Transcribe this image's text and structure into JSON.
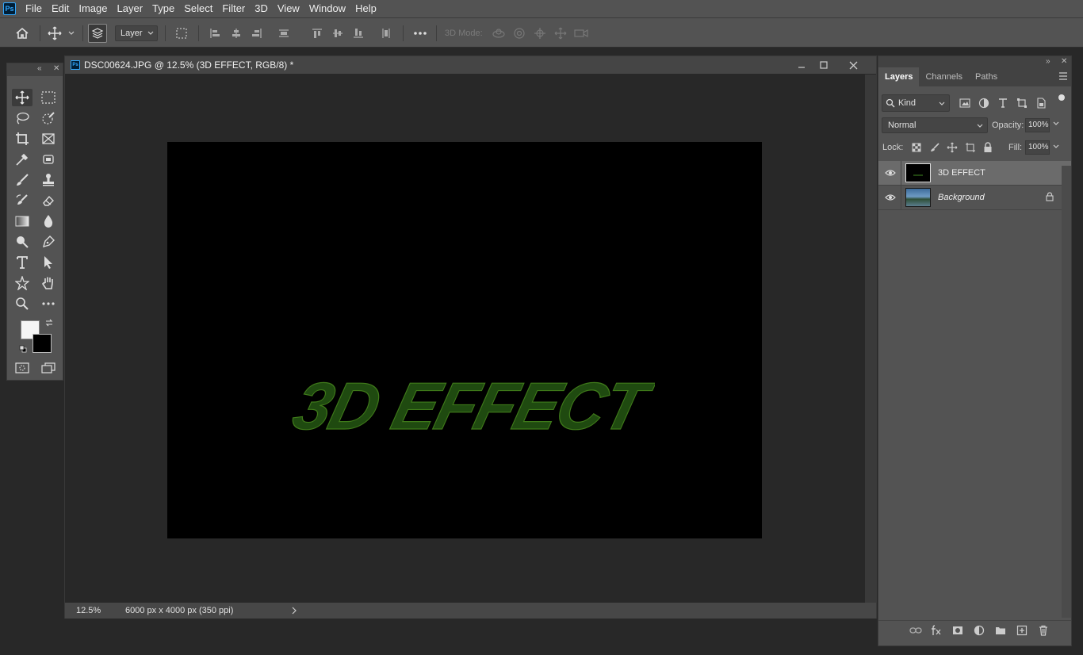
{
  "app": {
    "logo": "Ps"
  },
  "menu": [
    "File",
    "Edit",
    "Image",
    "Layer",
    "Type",
    "Select",
    "Filter",
    "3D",
    "View",
    "Window",
    "Help"
  ],
  "options_bar": {
    "auto_select_target": "Layer",
    "mode_3d_label": "3D Mode:"
  },
  "document": {
    "tab_title": "DSC00624.JPG @ 12.5% (3D EFFECT, RGB/8) *",
    "canvas_text": "3D EFFECT",
    "canvas_text_color": "#1f4a10",
    "canvas_text_outline": "#3f7a1a",
    "zoom": "12.5%",
    "info": "6000 px x 4000 px (350 ppi)"
  },
  "colors": {
    "foreground": "#f5f5f5",
    "background": "#000000",
    "accent": "#31a8ff"
  },
  "layers_panel": {
    "tabs": [
      "Layers",
      "Channels",
      "Paths"
    ],
    "active_tab": "Layers",
    "filter_kind": "Kind",
    "blend_mode": "Normal",
    "opacity_label": "Opacity:",
    "opacity": "100%",
    "lock_label": "Lock:",
    "fill_label": "Fill:",
    "fill": "100%",
    "layers": [
      {
        "name": "3D EFFECT",
        "visible": true,
        "selected": true,
        "locked": false
      },
      {
        "name": "Background",
        "visible": true,
        "selected": false,
        "locked": true
      }
    ]
  },
  "icons": {
    "tools": [
      "move-icon",
      "rectangular-marquee-icon",
      "lasso-icon",
      "quick-selection-icon",
      "crop-icon",
      "frame-icon",
      "eyedropper-icon",
      "patch-icon",
      "brush-icon",
      "stamp-icon",
      "history-brush-icon",
      "eraser-icon",
      "gradient-icon",
      "blur-icon",
      "dodge-icon",
      "pen-icon",
      "type-icon",
      "path-selection-icon",
      "shape-icon",
      "hand-icon",
      "zoom-icon",
      "more-tools-icon",
      "quick-mask-icon",
      "screen-mode-icon"
    ]
  }
}
